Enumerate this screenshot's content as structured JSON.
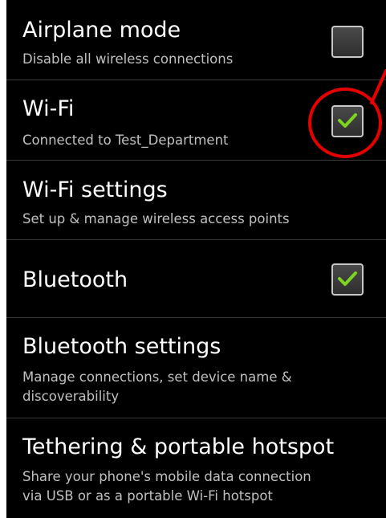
{
  "settings": [
    {
      "title": "Airplane mode",
      "summary": "Disable all wireless connections",
      "checked": false
    },
    {
      "title": "Wi-Fi",
      "summary": "Connected to Test_Department",
      "checked": true
    },
    {
      "title": "Wi-Fi settings",
      "summary": "Set up & manage wireless access points"
    },
    {
      "title": "Bluetooth",
      "checked": true
    },
    {
      "title": "Bluetooth settings",
      "summary_line1": "Manage connections, set device name &",
      "summary_line2": "discoverability"
    },
    {
      "title": "Tethering & portable hotspot",
      "summary_line1": "Share your phone's mobile data connection",
      "summary_line2": "via USB or as a portable Wi-Fi hotspot"
    }
  ],
  "colors": {
    "background": "#000000",
    "title_text": "#ffffff",
    "summary_text": "#c0c0c0",
    "checkmark": "#7ed321",
    "annotation": "#e60000",
    "divider": "#3a3a3a"
  },
  "icons": {
    "checkbox_checked": "checkmark-icon",
    "annotation": "red-circle-annotation"
  }
}
